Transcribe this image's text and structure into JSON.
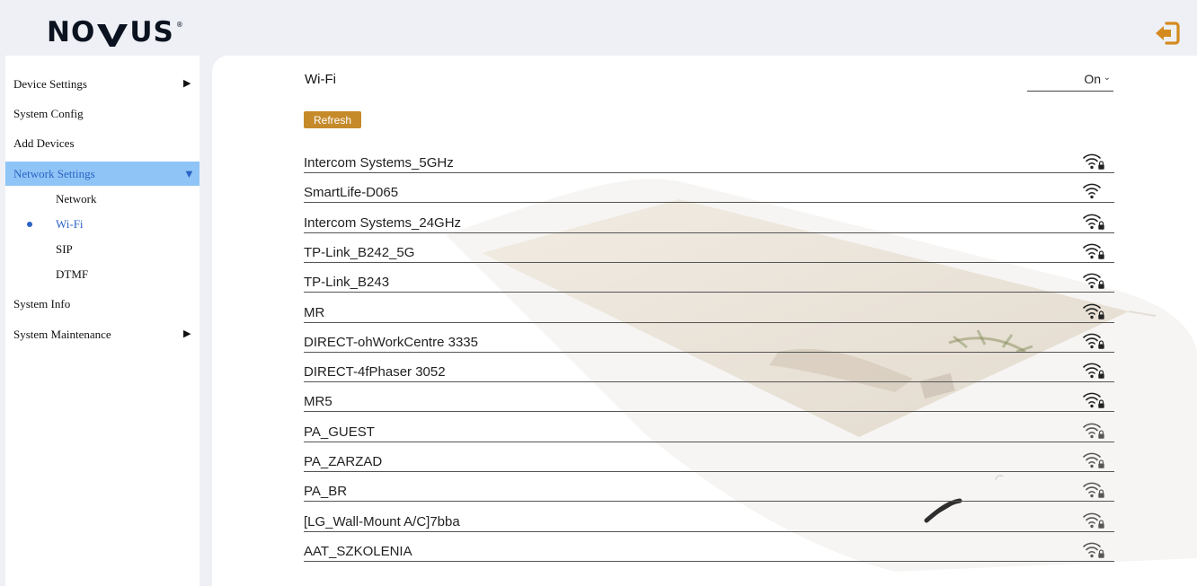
{
  "header": {
    "logo_text": "NOVUS",
    "logout_icon": "logout-icon"
  },
  "sidebar": {
    "items": [
      {
        "label": "Device Settings",
        "arrow": "▶"
      },
      {
        "label": "System Config"
      },
      {
        "label": "Add Devices"
      },
      {
        "label": "Network Settings",
        "arrow": "▼"
      },
      {
        "label": "System Info"
      },
      {
        "label": "System Maintenance",
        "arrow": "▶"
      }
    ],
    "network_sub": [
      {
        "label": "Network"
      },
      {
        "label": "Wi-Fi"
      },
      {
        "label": "SIP"
      },
      {
        "label": "DTMF"
      }
    ]
  },
  "main": {
    "wifi_label": "Wi-Fi",
    "wifi_state": "On",
    "refresh_label": "Refresh",
    "networks": [
      {
        "ssid": "Intercom Systems_5GHz",
        "icon": "wifi-locked-icon"
      },
      {
        "ssid": "SmartLife-D065",
        "icon": "wifi-icon"
      },
      {
        "ssid": "Intercom Systems_24GHz",
        "icon": "wifi-locked-icon"
      },
      {
        "ssid": "TP-Link_B242_5G",
        "icon": "wifi-locked-icon"
      },
      {
        "ssid": "TP-Link_B243",
        "icon": "wifi-locked-icon"
      },
      {
        "ssid": "MR",
        "icon": "wifi-locked-icon"
      },
      {
        "ssid": "DIRECT-ohWorkCentre 3335",
        "icon": "wifi-locked-icon"
      },
      {
        "ssid": "DIRECT-4fPhaser 3052",
        "icon": "wifi-locked-icon"
      },
      {
        "ssid": "MR5",
        "icon": "wifi-locked-icon"
      },
      {
        "ssid": "PA_GUEST",
        "icon": "wifi-locked-icon"
      },
      {
        "ssid": "PA_ZARZAD",
        "icon": "wifi-locked-icon"
      },
      {
        "ssid": "PA_BR",
        "icon": "wifi-locked-icon"
      },
      {
        "ssid": "[LG_Wall-Mount A/C]7bba",
        "icon": "wifi-locked-icon"
      },
      {
        "ssid": "AAT_SZKOLENIA",
        "icon": "wifi-locked-icon"
      }
    ]
  },
  "colors": {
    "accent": "#c58a2a",
    "active_nav_bg": "#8fc5f6",
    "active_nav_text": "#2b63c5",
    "page_bg": "#eef0f5"
  }
}
